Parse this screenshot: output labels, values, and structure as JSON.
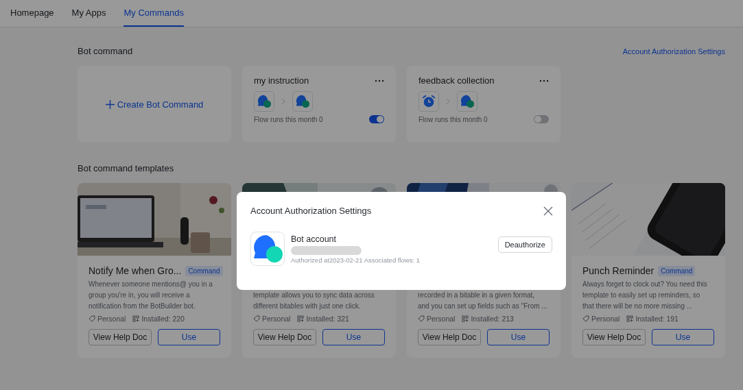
{
  "tabs": [
    {
      "label": "Homepage",
      "selected": false
    },
    {
      "label": "My Apps",
      "selected": false
    },
    {
      "label": "My Commands",
      "selected": true
    }
  ],
  "bot_command": {
    "title": "Bot command",
    "settings_link": "Account Authorization Settings",
    "create_label": "Create Bot Command",
    "commands": [
      {
        "name": "my instruction",
        "steps": [
          {
            "kind": "chat"
          },
          {
            "kind": "chat"
          }
        ],
        "runs": "Flow runs this month 0",
        "on": true
      },
      {
        "name": "feedback collection",
        "steps": [
          {
            "kind": "alarm"
          },
          {
            "kind": "chat"
          }
        ],
        "runs": "Flow runs this month 0",
        "on": false
      }
    ]
  },
  "templates": {
    "title": "Bot command templates",
    "items": [
      {
        "title": "Notify Me when Gro...",
        "badge": "Command",
        "description": [
          "Whenever someone mentions@ you in a",
          "group you're in, you will receive a",
          "notification from the BotBuilder bot."
        ],
        "scope": "Personal",
        "installed": "Installed: 220",
        "buttons": [
          "View Help Doc",
          "Use"
        ]
      },
      {
        "description": [
          "template allows you to sync data across",
          "different bitables with just one click."
        ],
        "scope": "Personal",
        "installed": "Installed: 321",
        "buttons": [
          "View Help Doc",
          "Use"
        ]
      },
      {
        "description": [
          "recorded in a bitable in a given format,",
          "and you can set up fields such as \"From ..."
        ],
        "scope": "Personal",
        "installed": "Installed: 213",
        "buttons": [
          "View Help Doc",
          "Use"
        ]
      },
      {
        "title": "Punch Reminder",
        "badge": "Command",
        "description": [
          "Always forget to clock out? You need this",
          "template to easily set up reminders, so",
          "that there will be no more missing ..."
        ],
        "scope": "Personal",
        "installed": "Installed: 191",
        "buttons": [
          "View Help Doc",
          "Use"
        ]
      }
    ]
  },
  "dialog": {
    "title": "Account Authorization Settings",
    "account": {
      "name": "Bot account",
      "meta": "Authorized at2023-02-21 Associated flows: 1"
    },
    "button": "Deauthorize"
  }
}
